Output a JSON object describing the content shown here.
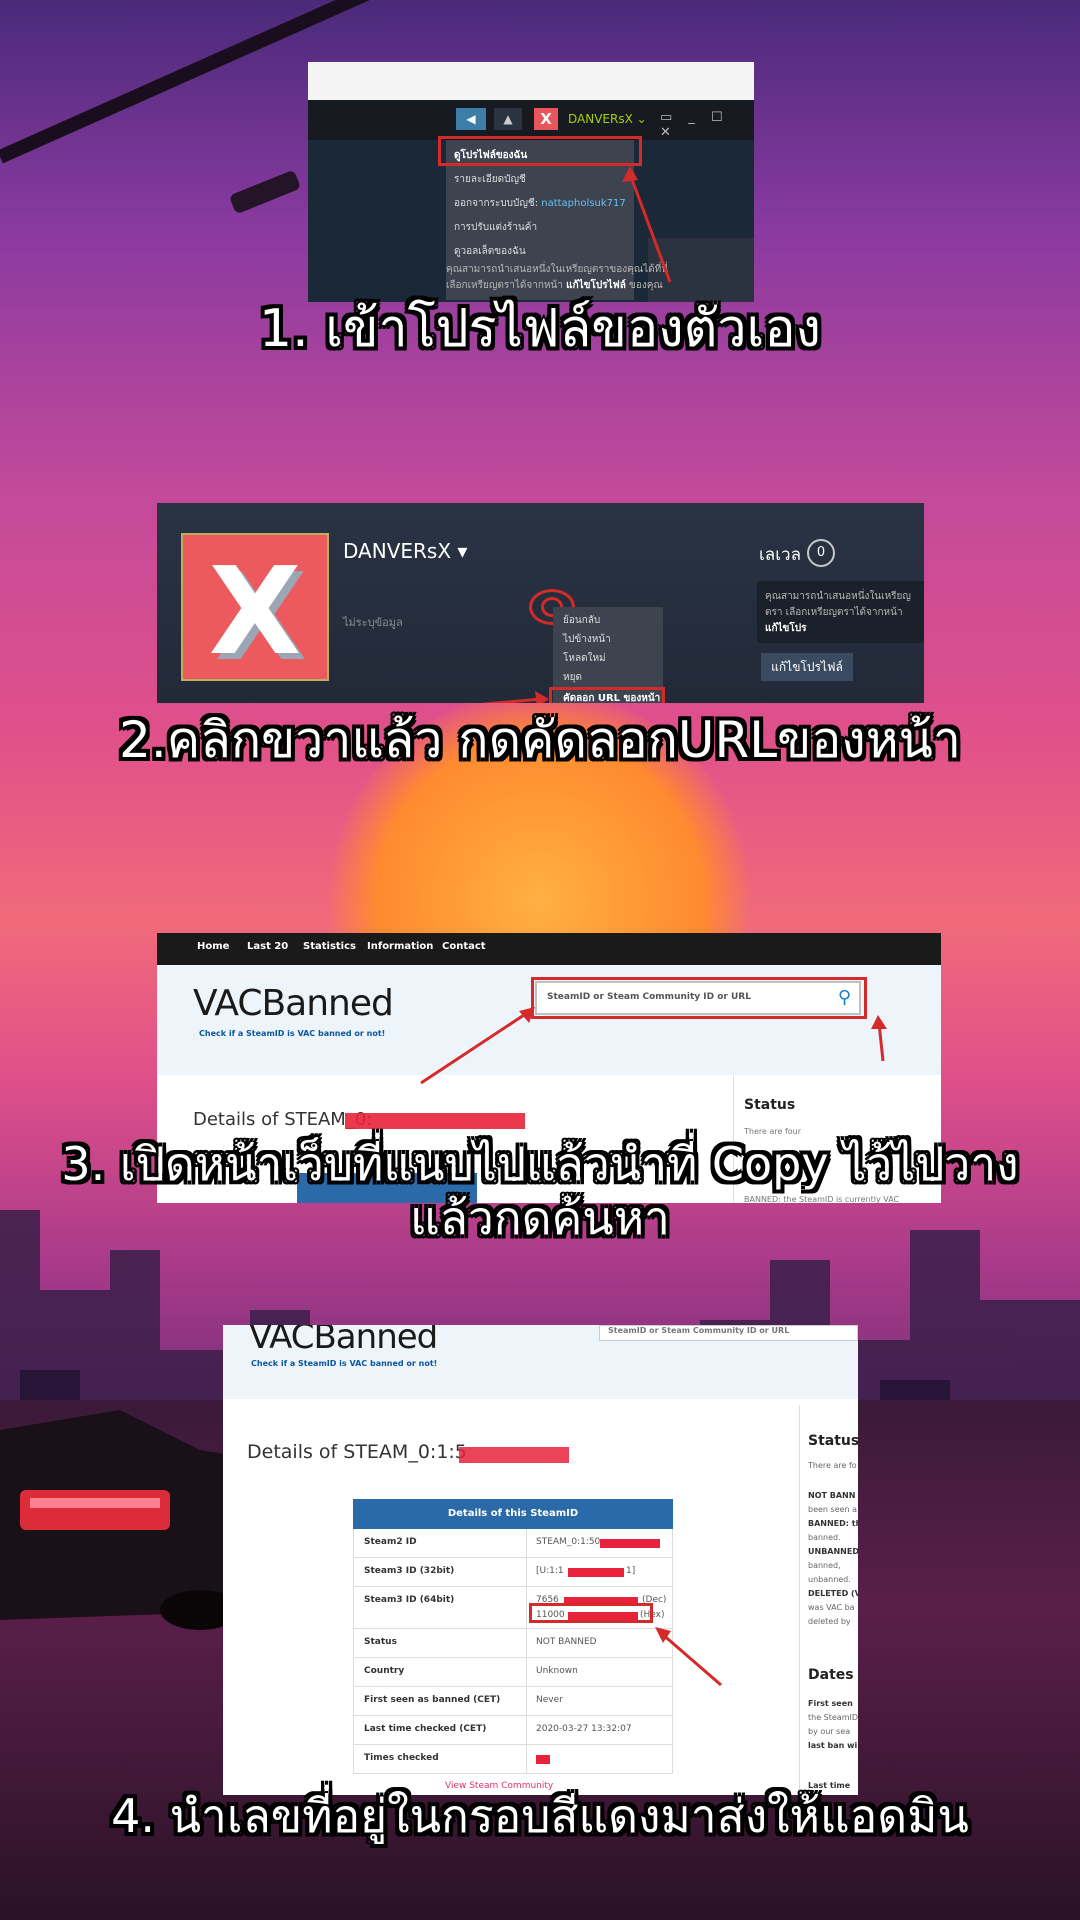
{
  "colors": {
    "highlight_red": "#d42a2a",
    "steam_dark": "#1b2838",
    "vac_blue": "#2a6aa8",
    "steam_green_name": "#a4d007"
  },
  "step1": {
    "caption": "1. เข้าโปรไฟล์ของตัวเอง",
    "username": "DANVERsX",
    "avatar_letter": "X",
    "menu_items": [
      "ดูโปรไฟล์ของฉัน",
      "รายละเอียดบัญชี",
      "ออกจากระบบบัญชี:",
      "การปรับแต่งร้านค้า",
      "ดูวอลเล็ตของฉัน"
    ],
    "account_name": "nattapholsuk717",
    "promo_text": "คุณสามารถนำเสนอหนึ่งในเหรียญตราของคุณได้ที่นี่ เลือกเหรียญตราได้จากหน้า",
    "promo_link": "แก้ไขโปรไฟล์",
    "promo_tail": "ของคุณ"
  },
  "step2": {
    "caption": "2.คลิกขวาแล้ว กดคัดลอกURLของหน้า",
    "profile_name": "DANVERsX ▾",
    "avatar_letter": "X",
    "no_info": "ไม่ระบุข้อมูล",
    "level_label": "เลเวล",
    "level_value": "0",
    "promo_text": "คุณสามารถนำเสนอหนึ่งในเหรียญตรา เลือกเหรียญตราได้จากหน้า",
    "promo_link": "แก้ไขโปร",
    "edit_button": "แก้ไขโปรไฟล์",
    "context_menu": [
      "ย้อนกลับ",
      "ไปข้างหน้า",
      "โหลดใหม่",
      "หยุด",
      "คัดลอก URL ของหน้า"
    ]
  },
  "step3": {
    "caption_line1": "3. เปิดหน้าเว็บที่แนบไปแล้วนำที่ Copy ไว้ไปวาง",
    "caption_line2": "แล้วกดค้นหา",
    "nav": [
      "Home",
      "Last 20",
      "Statistics",
      "Information",
      "Contact"
    ],
    "logo": "VACBanned",
    "tagline": "Check if a SteamID is VAC banned or not!",
    "search_placeholder": "SteamID or Steam Community ID or URL",
    "search_icon": "magnifier-icon",
    "details_title": "Details of STEAM_0:",
    "sidebar_title": "Status",
    "sidebar_text1": "There are four",
    "sidebar_text2": "BANNED: the SteamID is currently VAC"
  },
  "step4": {
    "caption": "4. นำเลขที่อยู่ในกรอบสีแดงมาส่งให้แอดมิน",
    "logo": "VACBanned",
    "tagline": "Check if a SteamID is VAC banned or not!",
    "search_placeholder": "SteamID or Steam Community ID or URL",
    "details_title": "Details of STEAM_0:1:5",
    "table_header": "Details of this SteamID",
    "rows": [
      {
        "key": "Steam2 ID",
        "value": "STEAM_0:1:50"
      },
      {
        "key": "Steam3 ID (32bit)",
        "value": "[U:1:1",
        "value_tail": "1]"
      },
      {
        "key": "Steam3 ID (64bit)",
        "value": "7656",
        "value_tail": "(Dec)",
        "value2": "11000",
        "value2_tail": "(Hex)"
      },
      {
        "key": "Status",
        "value": "NOT BANNED"
      },
      {
        "key": "Country",
        "value": "Unknown"
      },
      {
        "key": "First seen as banned (CET)",
        "value": "Never"
      },
      {
        "key": "Last time checked (CET)",
        "value": "2020-03-27 13:32:07"
      },
      {
        "key": "Times checked",
        "value": ""
      }
    ],
    "steam_link": "View Steam Community",
    "sidebar_title": "Status",
    "sidebar_lines": [
      "There are fo",
      "NOT BANN",
      "been seen a",
      "BANNED: th",
      "banned.",
      "UNBANNED",
      "banned,",
      "unbanned.",
      "DELETED (V",
      "was VAC ba",
      "deleted by"
    ],
    "sidebar_title2": "Dates",
    "sidebar_lines2": [
      "First seen",
      "the SteamID",
      "by our sea",
      "last ban wi",
      "",
      "Last time"
    ]
  }
}
